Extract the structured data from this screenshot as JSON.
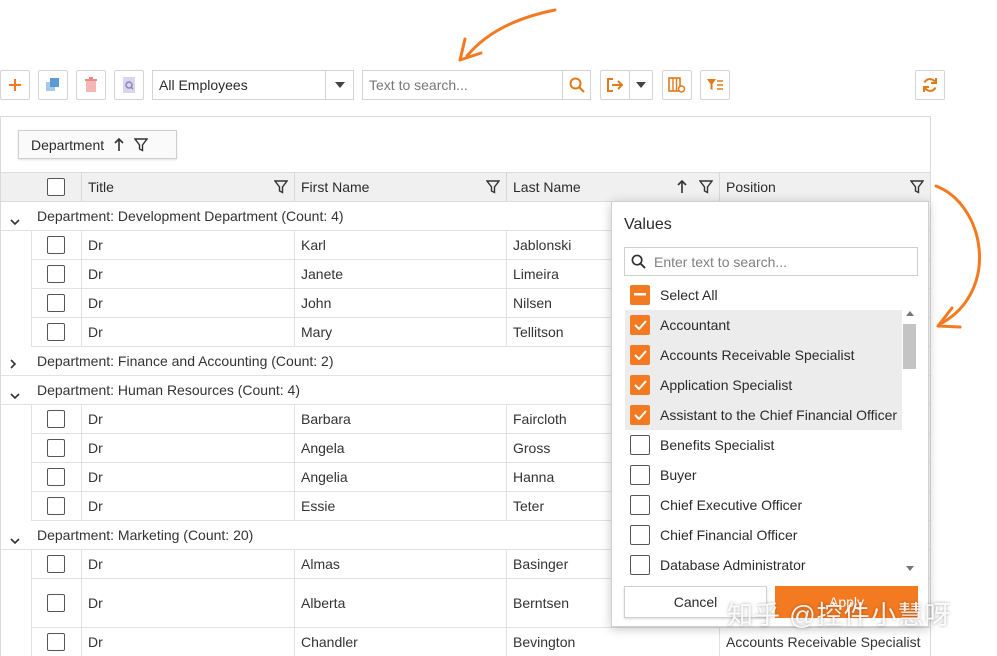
{
  "toolbar": {
    "employee_filter": "All Employees",
    "search_placeholder": "Text to search..."
  },
  "grid": {
    "group_panel_label": "Department",
    "columns": [
      "Title",
      "First Name",
      "Last Name",
      "Position"
    ],
    "groups": [
      {
        "label": "Department: Development Department (Count: 4)",
        "expanded": true,
        "rows": [
          {
            "title": "Dr",
            "first": "Karl",
            "last": "Jablonski"
          },
          {
            "title": "Dr",
            "first": "Janete",
            "last": "Limeira"
          },
          {
            "title": "Dr",
            "first": "John",
            "last": "Nilsen"
          },
          {
            "title": "Dr",
            "first": "Mary",
            "last": "Tellitson"
          }
        ]
      },
      {
        "label": "Department: Finance and Accounting (Count: 2)",
        "expanded": false,
        "rows": []
      },
      {
        "label": "Department: Human Resources (Count: 4)",
        "expanded": true,
        "rows": [
          {
            "title": "Dr",
            "first": "Barbara",
            "last": "Faircloth"
          },
          {
            "title": "Dr",
            "first": "Angela",
            "last": "Gross"
          },
          {
            "title": "Dr",
            "first": "Angelia",
            "last": "Hanna"
          },
          {
            "title": "Dr",
            "first": "Essie",
            "last": "Teter"
          }
        ]
      },
      {
        "label": "Department: Marketing (Count: 20)",
        "expanded": true,
        "rows": [
          {
            "title": "Dr",
            "first": "Almas",
            "last": "Basinger"
          },
          {
            "title": "Dr",
            "first": "Alberta",
            "last": "Berntsen"
          },
          {
            "title": "Dr",
            "first": "Chandler",
            "last": "Bevington",
            "position": "Accounts Receivable Specialist"
          }
        ]
      }
    ]
  },
  "filter_popup": {
    "title": "Values",
    "search_placeholder": "Enter text to search...",
    "select_all": "Select All",
    "options": [
      {
        "label": "Accountant",
        "checked": true
      },
      {
        "label": "Accounts Receivable Specialist",
        "checked": true
      },
      {
        "label": "Application Specialist",
        "checked": true
      },
      {
        "label": "Assistant to the Chief Financial Officer",
        "checked": true
      },
      {
        "label": "Benefits Specialist",
        "checked": false
      },
      {
        "label": "Buyer",
        "checked": false
      },
      {
        "label": "Chief Executive Officer",
        "checked": false
      },
      {
        "label": "Chief Financial Officer",
        "checked": false
      },
      {
        "label": "Database Administrator",
        "checked": false
      }
    ],
    "cancel": "Cancel",
    "apply": "Apply"
  },
  "watermark": "知乎 @控件小慧呀",
  "colors": {
    "accent": "#f47a21",
    "delete_red": "#e66a6a",
    "copy_blue": "#5b9bd5"
  }
}
